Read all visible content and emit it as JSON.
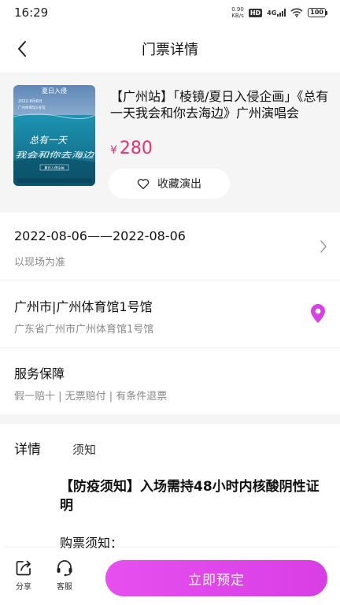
{
  "status_bar": {
    "time": "16:29",
    "net_speed_value": "0.90",
    "net_speed_unit": "KB/s",
    "hd": "HD",
    "signal_type": "4G",
    "battery": "100"
  },
  "header": {
    "title": "门票详情"
  },
  "ticket": {
    "title": "【广州站】「棱镜/夏日入侵企画」《总有一天我会和你去海边》广州演唱会",
    "currency": "¥",
    "price": "280",
    "favorite_label": "收藏演出",
    "poster_text": {
      "line1": "夏日入侵",
      "date": "2022·8月6日",
      "venue": "广州体育馆1号馆",
      "calligraphy1": "总有一天",
      "calligraphy2": "我会和你去海边",
      "band": "夏日入侵企画"
    }
  },
  "date_row": {
    "main": "2022-08-06——2022-08-06",
    "sub": "以现场为准"
  },
  "venue_row": {
    "main": "广州市|广州体育馆1号馆",
    "sub": "广东省广州市广州体育馆1号馆"
  },
  "service_row": {
    "main": "服务保障",
    "sub": "假一赔十 | 无票赔付 | 有条件退票"
  },
  "tabs": {
    "detail": "详情",
    "notice": "须知"
  },
  "content": {
    "notice_title": "【防疫须知】入场需持48小时内核酸阴性证明",
    "purchase_heading": "购票须知："
  },
  "bottom_bar": {
    "share_label": "分享",
    "service_label": "客服",
    "book_label": "立即预定"
  },
  "colors": {
    "price": "#ee2f69",
    "book_button": "#df47ea",
    "pin": "#d93fe4"
  }
}
